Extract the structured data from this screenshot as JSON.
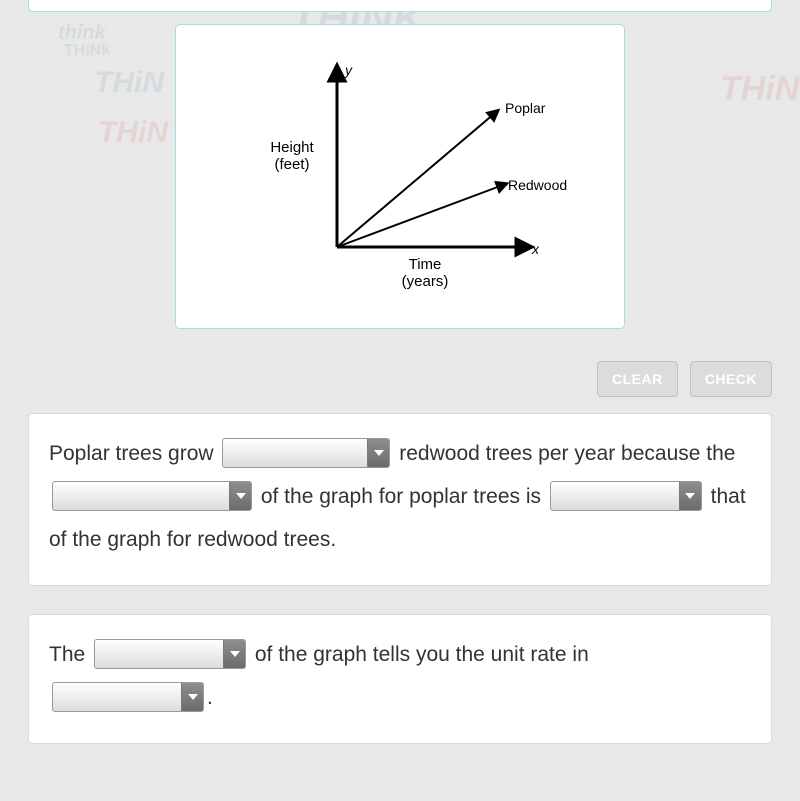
{
  "graph": {
    "y_axis_label": "y",
    "x_axis_label": "x",
    "y_title_line1": "Height",
    "y_title_line2": "(feet)",
    "x_title_line1": "Time",
    "x_title_line2": "(years)",
    "line1_label": "Poplar",
    "line2_label": "Redwood"
  },
  "buttons": {
    "clear": "CLEAR",
    "check": "CHECK"
  },
  "sentence1": {
    "part1": "Poplar trees grow ",
    "part2": " redwood trees per year because the ",
    "part3": " of the graph for poplar trees is ",
    "part4": " that of the graph for redwood trees."
  },
  "sentence2": {
    "part1": "The ",
    "part2": " of the graph tells you the unit rate in ",
    "part3": "."
  },
  "chart_data": {
    "type": "line",
    "title": "",
    "xlabel": "Time (years)",
    "ylabel": "Height (feet)",
    "series": [
      {
        "name": "Poplar",
        "slope_relative": "steep"
      },
      {
        "name": "Redwood",
        "slope_relative": "shallow"
      }
    ],
    "note": "Qualitative graph with no numeric tick labels; two rays from origin, Poplar steeper than Redwood."
  }
}
